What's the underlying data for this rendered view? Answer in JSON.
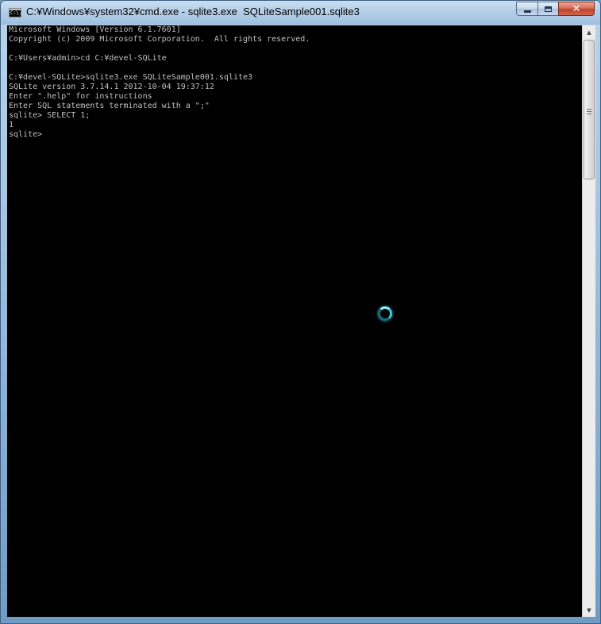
{
  "window": {
    "title": "C:¥Windows¥system32¥cmd.exe - sqlite3.exe  SQLiteSample001.sqlite3",
    "icon": "cmd-console-icon",
    "icon_text": "C:\\.",
    "buttons": {
      "minimize": "minimize-icon",
      "maximize": "maximize-icon",
      "close_label": "✕"
    }
  },
  "console": {
    "lines": [
      "Microsoft Windows [Version 6.1.7601]",
      "Copyright (c) 2009 Microsoft Corporation.  All rights reserved.",
      "",
      "C:¥Users¥admin>cd C:¥devel-SQLite",
      "",
      "C:¥devel-SQLite>sqlite3.exe SQLiteSample001.sqlite3",
      "SQLite version 3.7.14.1 2012-10-04 19:37:12",
      "Enter \".help\" for instructions",
      "Enter SQL statements terminated with a \";\"",
      "sqlite> SELECT 1;",
      "1",
      "sqlite>"
    ],
    "text_color": "#c0c0c0",
    "background": "#000000"
  },
  "scrollbar": {
    "up_arrow": "▲",
    "down_arrow": "▼"
  },
  "colors": {
    "busy_spinner": "#3cc7e0",
    "close_button": "#c0422a"
  }
}
